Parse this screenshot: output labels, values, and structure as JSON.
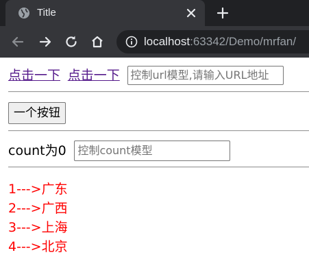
{
  "browser": {
    "tab": {
      "title": "Title"
    },
    "address": {
      "host": "localhost",
      "rest": ":63342/Demo/mrfan/"
    }
  },
  "page": {
    "links": [
      "点击一下",
      "点击一下"
    ],
    "url_input": {
      "placeholder": "控制url模型,请输入URL地址"
    },
    "button_label": "一个按钮",
    "count_label": "count为0",
    "count_input": {
      "placeholder": "控制count模型"
    },
    "list_items": [
      "1--->广东",
      "2--->广西",
      "3--->上海",
      "4--->北京"
    ],
    "colors": {
      "link": "#551a8b",
      "list_text": "#ff0000"
    }
  }
}
